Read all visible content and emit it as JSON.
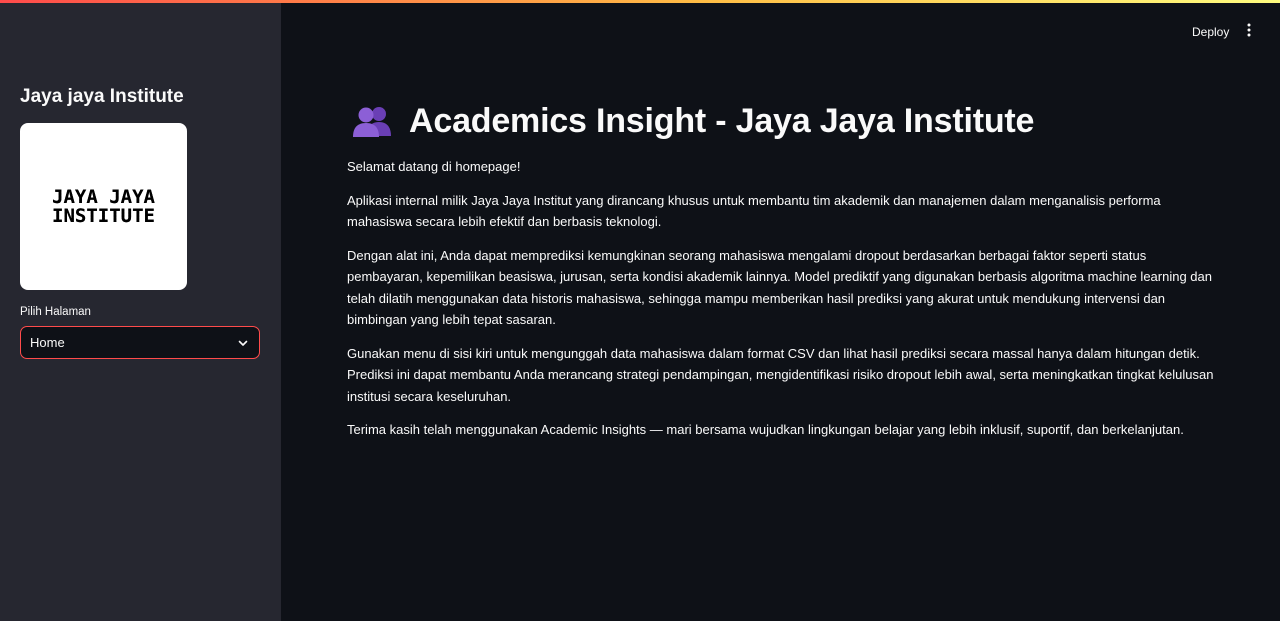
{
  "sidebar": {
    "title": "Jaya jaya Institute",
    "logo": {
      "line1": "JAYA JAYA",
      "line2": "INSTITUTE"
    },
    "select": {
      "label": "Pilih Halaman",
      "value": "Home"
    }
  },
  "header": {
    "deploy_label": "Deploy"
  },
  "main": {
    "title": "Academics Insight - Jaya Jaya Institute",
    "title_icon": "people-icon",
    "paragraphs": [
      "Selamat datang di homepage!",
      "Aplikasi internal milik Jaya Jaya Institut yang dirancang khusus untuk membantu tim akademik dan manajemen dalam menganalisis performa mahasiswa secara lebih efektif dan berbasis teknologi.",
      "Dengan alat ini, Anda dapat memprediksi kemungkinan seorang mahasiswa mengalami dropout berdasarkan berbagai faktor seperti status pembayaran, kepemilikan beasiswa, jurusan, serta kondisi akademik lainnya. Model prediktif yang digunakan berbasis algoritma machine learning dan telah dilatih menggunakan data historis mahasiswa, sehingga mampu memberikan hasil prediksi yang akurat untuk mendukung intervensi dan bimbingan yang lebih tepat sasaran.",
      "Gunakan menu di sisi kiri untuk mengunggah data mahasiswa dalam format CSV dan lihat hasil prediksi secara massal hanya dalam hitungan detik. Prediksi ini dapat membantu Anda merancang strategi pendampingan, mengidentifikasi risiko dropout lebih awal, serta meningkatkan tingkat kelulusan institusi secara keseluruhan.",
      "Terima kasih telah menggunakan Academic Insights — mari bersama wujudkan lingkungan belajar yang lebih inklusif, suportif, dan berkelanjutan."
    ]
  },
  "colors": {
    "background": "#0e1117",
    "sidebar": "#262730",
    "accent": "#ff4b4b",
    "text": "#fafafa",
    "icon_purple": "#7e57c2"
  }
}
